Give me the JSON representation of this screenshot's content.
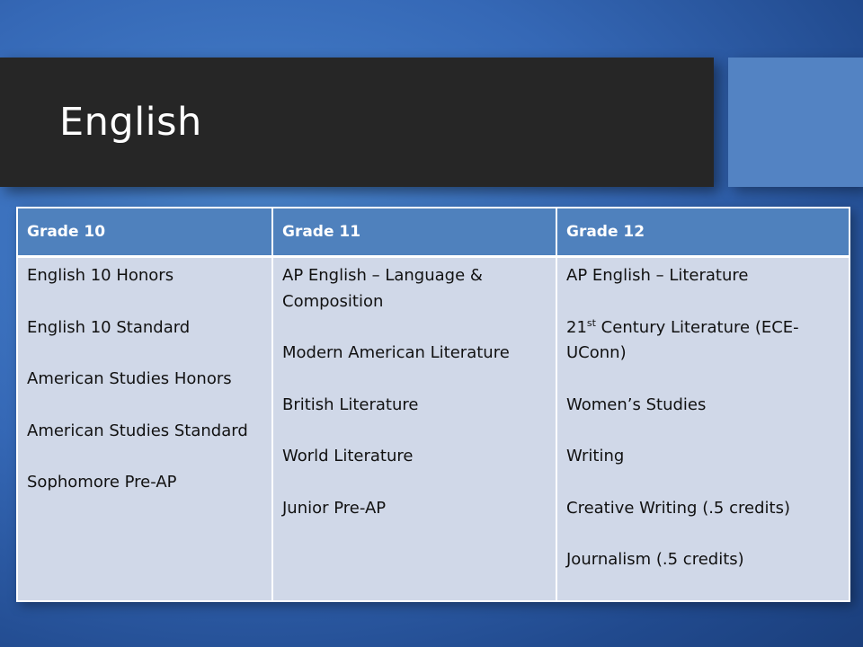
{
  "slide": {
    "title": "English"
  },
  "table": {
    "headers": [
      "Grade 10",
      "Grade 11",
      "Grade 12"
    ],
    "grade10": [
      "English 10 Honors",
      "English 10 Standard",
      "American Studies Honors",
      "American Studies Standard",
      "Sophomore Pre-AP"
    ],
    "grade11": [
      "AP English – Language & Composition",
      "Modern American Literature",
      "British Literature",
      "World Literature",
      "Junior Pre-AP"
    ],
    "grade12": {
      "c0": "AP English – Literature",
      "c1_num": "21",
      "c1_sup": "st",
      "c1_rest": " Century Literature (ECE-UConn)",
      "c2": "Women’s Studies",
      "c3": "Writing",
      "c4": "Creative Writing (.5 credits)",
      "c5": "Journalism (.5 credits)"
    }
  }
}
